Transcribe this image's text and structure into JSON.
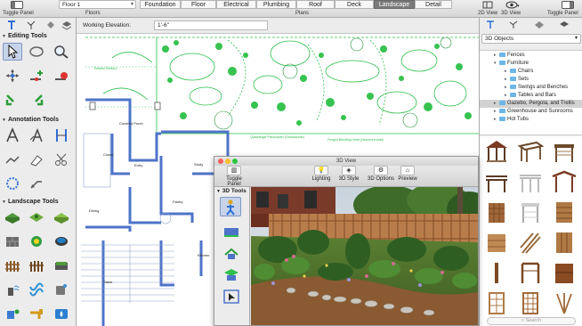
{
  "toolbar": {
    "left_toggle_label": "Toggle Panel",
    "floor_value": "Floor 1",
    "floors_label": "Floors",
    "plans_label": "Plans",
    "plan_tabs": [
      "Foundation",
      "Floor",
      "Electrical",
      "Plumbing",
      "Roof",
      "Deck",
      "Landscape",
      "Detail"
    ],
    "active_tab": "Landscape",
    "view2d_label": "2D View",
    "view3d_label": "3D View",
    "right_toggle_label": "Toggle Panel"
  },
  "left_panel": {
    "editing_tools_label": "Editing Tools",
    "annotation_tools_label": "Annotation Tools",
    "landscape_tools_label": "Landscape Tools"
  },
  "elevation": {
    "label": "Working Elevation:",
    "value": "1'-6\""
  },
  "plan_labels": {
    "covered_porch": "Covered Porch",
    "entry": "Entry",
    "study": "Study",
    "dining": "Dining",
    "pantry": "Pantry",
    "kitchen": "Kitchen",
    "stairs": "Stairs",
    "closet": "Closet",
    "plant1": "Quadrangle Philosopher (Orchidaceae)",
    "plant2": "Fringed Bleeding Heart (Dicentra eximia)"
  },
  "right_panel": {
    "library_value": "3D Objects",
    "tree": [
      {
        "label": "Fences",
        "level": 1
      },
      {
        "label": "Furniture",
        "level": 1
      },
      {
        "label": "Chairs",
        "level": 2
      },
      {
        "label": "Sets",
        "level": 2
      },
      {
        "label": "Swings and Benches",
        "level": 2
      },
      {
        "label": "Tables and Bars",
        "level": 2
      },
      {
        "label": "Gazebo, Pergola, and Trellis",
        "level": 1
      },
      {
        "label": "Greenhouse and Sunrooms",
        "level": 1
      },
      {
        "label": "Hot Tubs",
        "level": 1
      }
    ],
    "selected_item": "Gazebo, Pergola, and Trellis",
    "search_placeholder": "Search"
  },
  "view3d": {
    "title": "3D View",
    "toggle_label": "Toggle Panel",
    "buttons": [
      "Lighting",
      "3D Style",
      "3D Options",
      "Preview"
    ],
    "side_header": "3D Tools"
  },
  "colors": {
    "active_tab": "#7b7b7b",
    "plan_green": "#2bbf4a",
    "wall_blue": "#4e74c9",
    "selection": "#c7d3e8",
    "folder": "#6cb6e8"
  }
}
